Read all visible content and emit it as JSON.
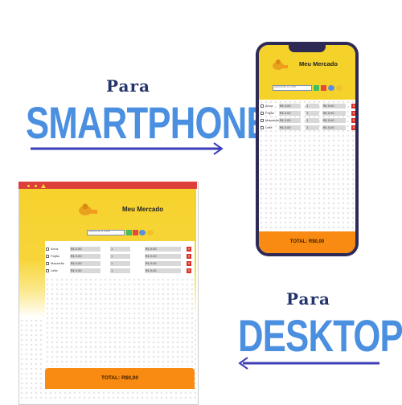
{
  "promo": {
    "para_top": "Para",
    "smartphone": "SMARTPHONE",
    "para_bottom": "Para",
    "desktop": "DESKTOP",
    "arrow_color": "#3d3db8"
  },
  "app": {
    "title": "Meu Mercado",
    "input_placeholder": "Adicione o Item",
    "colors": {
      "header": "#f5d22a",
      "footer": "#f98a12",
      "add": "#3fbf62",
      "clear": "#e24a3c",
      "delete": "#d9302a"
    },
    "items": [
      {
        "name": "Arroz",
        "price": "R$ 0.00",
        "qty": "1",
        "total": "R$ 0.00"
      },
      {
        "name": "Feijão",
        "price": "R$ 0.00",
        "qty": "1",
        "total": "R$ 0.00"
      },
      {
        "name": "Macarrão",
        "price": "R$ 0.00",
        "qty": "1",
        "total": "R$ 0.00"
      },
      {
        "name": "Leite",
        "price": "R$ 0.00",
        "qty": "1",
        "total": "R$ 0.00"
      }
    ],
    "phone_total": "TOTAL: R$0,00",
    "desktop_total": "TOTAL: R$0,00"
  }
}
